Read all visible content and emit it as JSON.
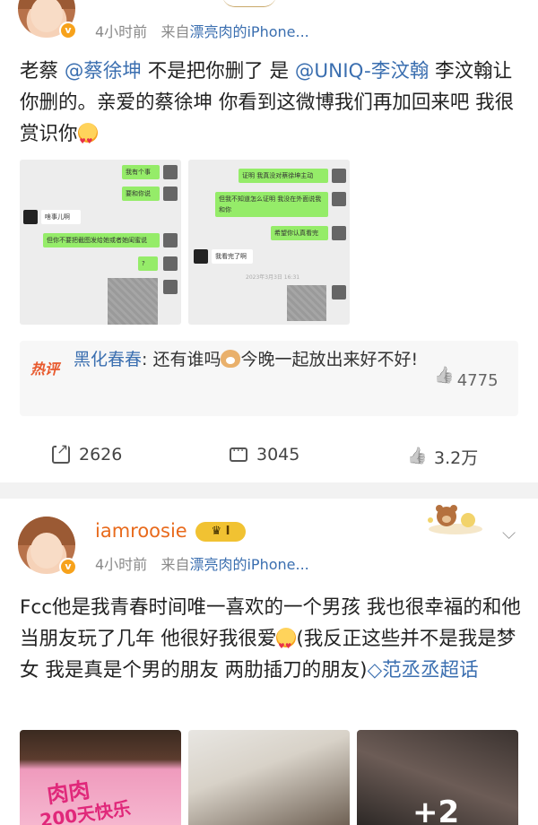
{
  "post1": {
    "time": "4小时前",
    "source_prefix": "来自",
    "source": "漂亮肉的iPhone...",
    "text": {
      "p1": "老蔡 ",
      "m1": "@蔡徐坤",
      "p2": " 不是把你删了 是 ",
      "m2": "@UNIQ-李汶翰",
      "p3": " 李汶翰让你删的。亲爱的蔡徐坤 你看到这微博我们再加回来吧 我很赏识你"
    },
    "chat1": {
      "msgs": [
        "我有个事",
        "要和你说",
        "啥事儿啊",
        "但你不要把截图发给她或者她闺蜜说",
        "?"
      ]
    },
    "chat2": {
      "msgs": [
        "证明 我真没对蔡徐坤主动",
        "但我不知道怎么证明 我没在外面说我和你",
        "希望你认真看完",
        "我看完了啊"
      ],
      "timestamp": "2023年3月3日 16:31"
    },
    "hot_comment": {
      "tag": "热评",
      "name": "黑化春春",
      "text_before": ": 还有谁吗",
      "text_after": "今晚一起放出来好不好!",
      "likes": "4775"
    },
    "actions": {
      "shares": "2626",
      "comments": "3045",
      "likes": "3.2万"
    }
  },
  "post2": {
    "username": "iamroosie",
    "level": "I",
    "time": "4小时前",
    "source_prefix": "来自",
    "source": "漂亮肉的iPhone...",
    "text": {
      "p1": "Fcc他是我青春时间唯一喜欢的一个男孩 我也很幸福的和他当朋友玩了几年 他很好我很爱",
      "p2": "(我反正这些并不是我是梦女 我是真是个男的朋友 两肋插刀的朋友)",
      "topic": "范丞丞超话"
    },
    "images": {
      "cake_line1": "肉肉",
      "cake_line2": "200天快乐",
      "more_count": "+2"
    }
  },
  "colors": {
    "mention": "#3b6fb0",
    "hot_tag": "#e8592d",
    "username": "#e86a1c",
    "vip_badge": "#f7a21b"
  }
}
